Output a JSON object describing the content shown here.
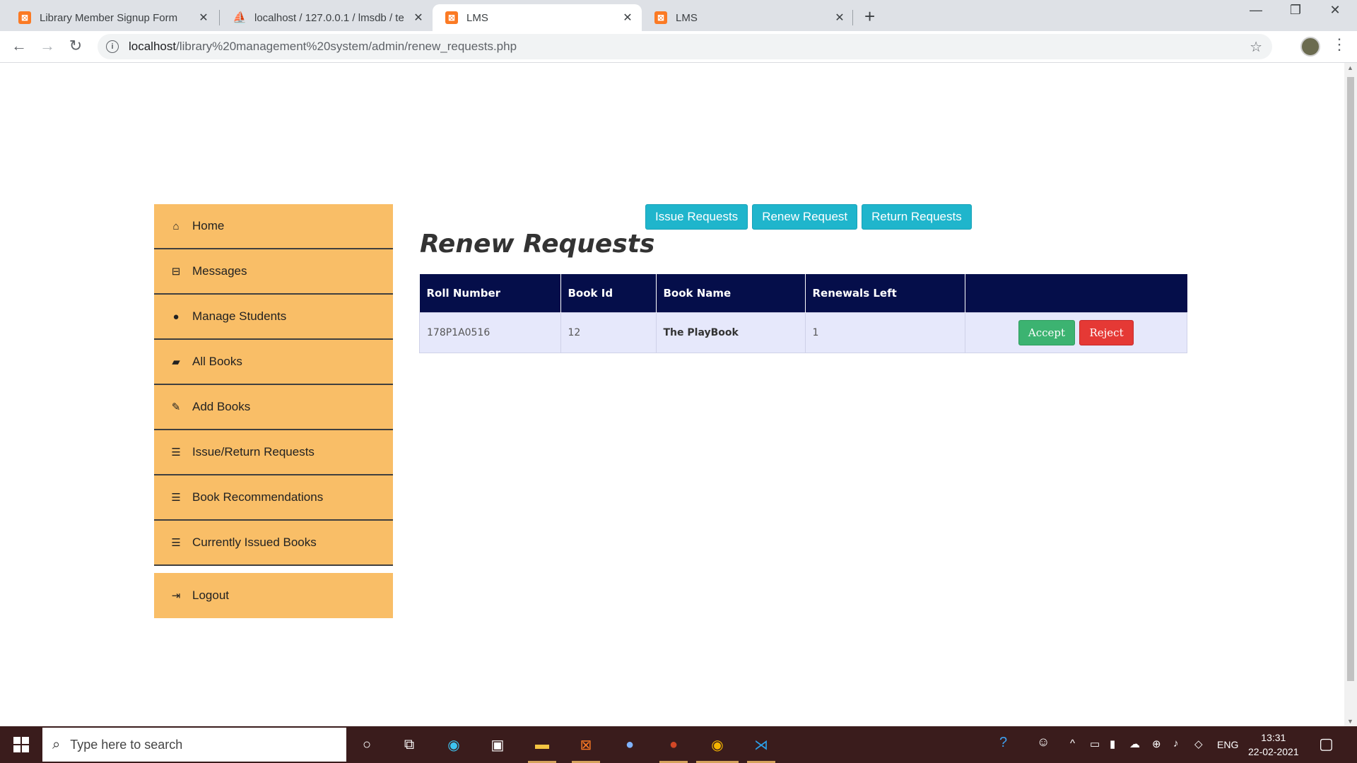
{
  "browser": {
    "tabs": [
      {
        "title": "Library Member Signup Form",
        "icon": "xampp-icon"
      },
      {
        "title": "localhost / 127.0.0.1 / lmsdb / te",
        "icon": "phpmyadmin-icon"
      },
      {
        "title": "LMS",
        "icon": "xampp-icon",
        "active": true
      },
      {
        "title": "LMS",
        "icon": "xampp-icon"
      }
    ],
    "url_host": "localhost",
    "url_path": "/library%20management%20system/admin/renew_requests.php"
  },
  "sidebar": {
    "items": [
      {
        "label": "Home",
        "icon": "home-icon"
      },
      {
        "label": "Messages",
        "icon": "inbox-icon"
      },
      {
        "label": "Manage Students",
        "icon": "user-icon"
      },
      {
        "label": "All Books",
        "icon": "book-icon"
      },
      {
        "label": "Add Books",
        "icon": "edit-icon"
      },
      {
        "label": "Issue/Return Requests",
        "icon": "tasks-icon"
      },
      {
        "label": "Book Recommendations",
        "icon": "list-icon"
      },
      {
        "label": "Currently Issued Books",
        "icon": "list-icon"
      }
    ],
    "logout": {
      "label": "Logout",
      "icon": "sign-out-icon"
    }
  },
  "nav_buttons": {
    "issue": "Issue Requests",
    "renew": "Renew Request",
    "return": "Return Requests"
  },
  "main": {
    "title": "Renew Requests",
    "table": {
      "headers": [
        "Roll Number",
        "Book Id",
        "Book Name",
        "Renewals Left",
        ""
      ],
      "rows": [
        {
          "roll": "178P1A0516",
          "book_id": "12",
          "book_name": "The PlayBook",
          "renewals_left": "1",
          "accept": "Accept",
          "reject": "Reject"
        }
      ]
    }
  },
  "taskbar": {
    "search_placeholder": "Type here to search",
    "language": "ENG",
    "time": "13:31",
    "date": "22-02-2021"
  },
  "colors": {
    "sidebar_bg": "#f9be67",
    "header_bg": "#050e4a",
    "row_bg": "#e6e8fb",
    "info_btn": "#1fb5cc",
    "accept": "#3cb371",
    "reject": "#e53935"
  }
}
